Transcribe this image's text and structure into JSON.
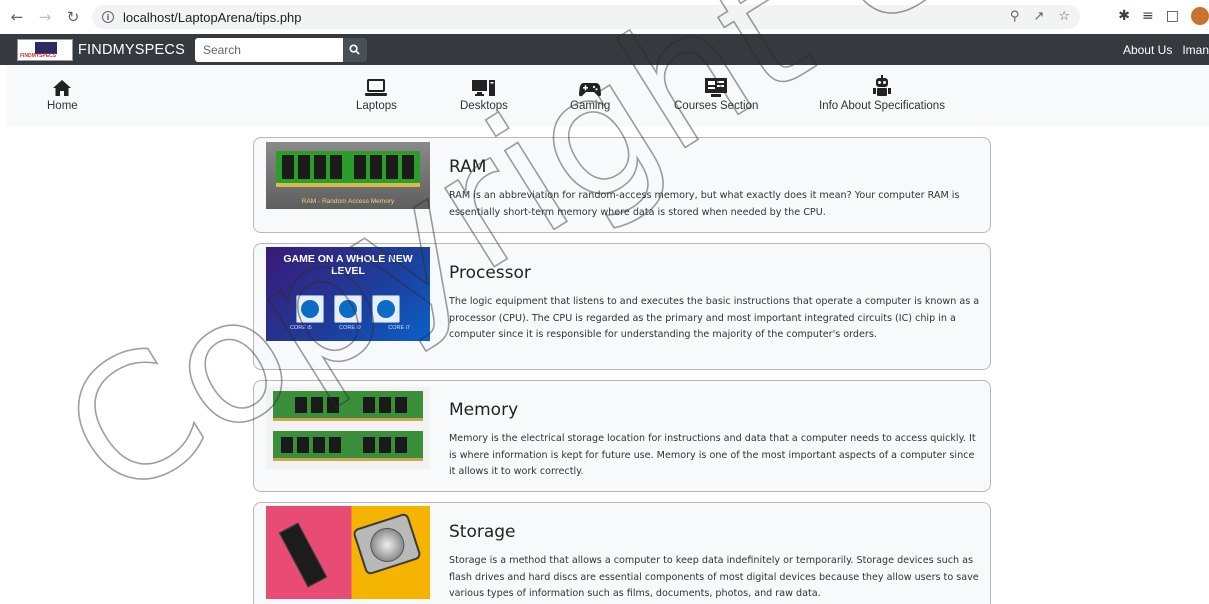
{
  "browser": {
    "url": "localhost/LaptopArena/tips.php"
  },
  "navbar": {
    "brand": "FINDMYSPECS",
    "logo_text": "FINDMYSPECS",
    "search_placeholder": "Search",
    "right_links": [
      "About Us",
      "Iman"
    ]
  },
  "categories": [
    {
      "label": "Home",
      "icon": "home-icon"
    },
    {
      "label": "Laptops",
      "icon": "laptop-icon"
    },
    {
      "label": "Desktops",
      "icon": "desktop-icon"
    },
    {
      "label": "Gaming",
      "icon": "gamepad-icon"
    },
    {
      "label": "Courses Section",
      "icon": "courses-icon"
    },
    {
      "label": "Info About Specifications",
      "icon": "robot-icon"
    }
  ],
  "cards": [
    {
      "title": "RAM",
      "description": "RAM is an abbreviation for random-access memory, but what exactly does it mean? Your computer RAM is essentially short-term memory where data is stored when needed by the CPU.",
      "image_caption": "RAM - Random Access Memory"
    },
    {
      "title": "Processor",
      "description": "The logic equipment that listens to and executes the basic instructions that operate a computer is known as a processor (CPU). The CPU is regarded as the primary and most important integrated circuits (IC) chip in a computer since it is responsible for understanding the majority of the computer's orders.",
      "image_headline": "GAME ON A WHOLE NEW LEVEL",
      "chip_labels": [
        "CORE i5",
        "CORE i9",
        "CORE i7"
      ]
    },
    {
      "title": "Memory",
      "description": "Memory is the electrical storage location for instructions and data that a computer needs to access quickly. It is where information is kept for future use. Memory is one of the most important aspects of a computer since it allows it to work correctly."
    },
    {
      "title": "Storage",
      "description": "Storage is a method that allows a computer to keep data indefinitely or temporarily. Storage devices such as flash drives and hard discs are essential components of most digital devices because they allow users to save various types of information such as films, documents, photos, and raw data."
    }
  ],
  "watermark": "Copyright UK"
}
